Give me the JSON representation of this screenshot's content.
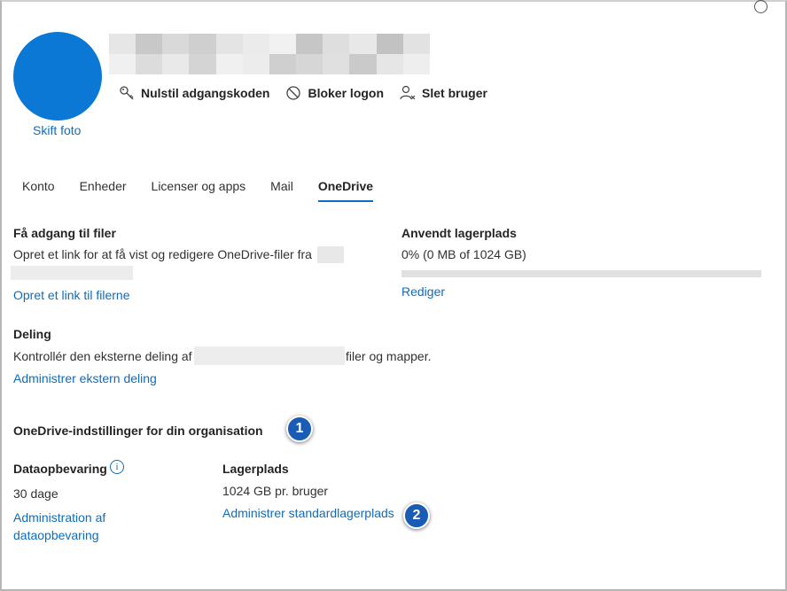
{
  "header": {
    "change_photo": "Skift foto",
    "actions": [
      {
        "label": "Nulstil adgangskoden",
        "icon": "key-icon"
      },
      {
        "label": "Bloker logon",
        "icon": "block-icon"
      },
      {
        "label": "Slet bruger",
        "icon": "delete-user-icon"
      }
    ]
  },
  "tabs": [
    "Konto",
    "Enheder",
    "Licenser og apps",
    "Mail",
    "OneDrive"
  ],
  "active_tab": "OneDrive",
  "files": {
    "title": "Få adgang til filer",
    "description": "Opret et link for at få vist og redigere OneDrive-filer fra",
    "link": "Opret et link til filerne"
  },
  "storage_used": {
    "title": "Anvendt lagerplads",
    "value": "0% (0 MB of 1024 GB)",
    "percent": 0,
    "edit_link": "Rediger"
  },
  "sharing": {
    "title": "Deling",
    "description_prefix": "Kontrollér den eksterne deling af",
    "description_suffix": "filer og mapper.",
    "link": "Administrer ekstern deling"
  },
  "org_settings": {
    "title": "OneDrive-indstillinger for din organisation",
    "badge1": "1",
    "badge2": "2",
    "retention": {
      "title": "Dataopbevaring",
      "value": "30 dage",
      "link_line1": "Administration af",
      "link_line2": "dataopbevaring"
    },
    "storage": {
      "title": "Lagerplads",
      "value": "1024 GB pr. bruger",
      "link": "Administrer standardlagerplads"
    }
  },
  "colors": {
    "accent": "#0f6cbd",
    "avatar": "#0a78d4",
    "badge": "#1a5bb5"
  }
}
